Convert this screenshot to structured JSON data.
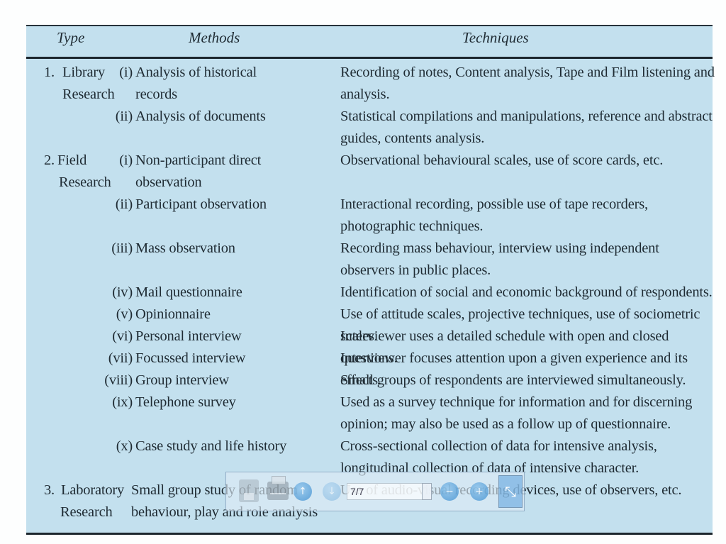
{
  "table": {
    "headers": {
      "type": "Type",
      "methods": "Methods",
      "techniques": "Techniques"
    },
    "rows": [
      {
        "type_num": "1.",
        "type_lines": [
          "Library",
          "Research"
        ],
        "method_num": "(i)",
        "method_lines": [
          "Analysis of historical",
          "records"
        ],
        "technique": "Recording of notes, Content analysis, Tape and Film listening and analysis."
      },
      {
        "method_num": "(ii)",
        "method_lines": [
          "Analysis of documents"
        ],
        "technique": "Statistical compilations and manipulations, reference and abstract guides, contents analysis."
      },
      {
        "type_num": "2.",
        "type_lines": [
          "Field",
          "Research"
        ],
        "method_num": "(i)",
        "method_lines": [
          "Non-participant direct",
          "observation"
        ],
        "technique": "Observational behavioural scales, use of score cards, etc."
      },
      {
        "method_num": "(ii)",
        "method_lines": [
          "Participant observation"
        ],
        "technique": "Interactional recording, possible use of tape recorders, photographic techniques."
      },
      {
        "method_num": "(iii)",
        "method_lines": [
          "Mass observation"
        ],
        "technique": "Recording mass behaviour, interview using independent observers in public places."
      },
      {
        "method_num": "(iv)",
        "method_lines": [
          "Mail questionnaire"
        ],
        "technique": "Identification of social and economic background of respondents."
      },
      {
        "method_num": "(v)",
        "method_lines": [
          "Opinionnaire"
        ],
        "technique": "Use of attitude scales, projective techniques, use of sociometric scales."
      },
      {
        "method_num": "(vi)",
        "method_lines": [
          "Personal interview"
        ],
        "technique": "Interviewer uses a detailed schedule with open and closed questions."
      },
      {
        "method_num": "(vii)",
        "method_lines": [
          "Focussed interview"
        ],
        "technique": "Interviewer focuses attention upon a given experience and its effects."
      },
      {
        "method_num": "(viii)",
        "method_lines": [
          "Group interview"
        ],
        "technique": "Small groups of respondents are interviewed simultaneously."
      },
      {
        "method_num": "(ix)",
        "method_lines": [
          "Telephone survey"
        ],
        "technique": "Used as a survey technique for information and for discerning opinion; may also be used as a follow up of questionnaire."
      },
      {
        "method_num": "(x)",
        "method_lines": [
          "Case study and life history"
        ],
        "technique": "Cross-sectional collection of data for intensive analysis, longitudinal collection of data of intensive character."
      },
      {
        "type_num": "3.",
        "type_lines": [
          "Laboratory",
          "Research"
        ],
        "method_num": "",
        "method_lines": [
          "Small group study of random",
          "behaviour, play and role analysis"
        ],
        "technique": "Use of audio-visual recording devices, use of observers, etc."
      }
    ]
  },
  "toolbar": {
    "save_icon": "save-icon",
    "print_icon": "print-icon",
    "prev_icon": "arrow-up-icon",
    "next_icon": "arrow-down-icon",
    "page_value": "7/7",
    "zoom_out_icon": "minus-icon",
    "zoom_in_icon": "plus-icon",
    "fit_icon": "exit-fullscreen-icon",
    "prev_glyph": "↑",
    "next_glyph": "↓",
    "zoom_out_glyph": "−",
    "zoom_in_glyph": "+",
    "fit_glyph": "⤡"
  }
}
